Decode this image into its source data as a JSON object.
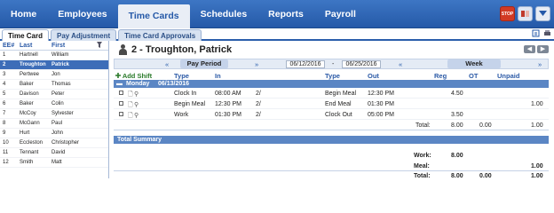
{
  "nav": {
    "items": [
      "Home",
      "Employees",
      "Time Cards",
      "Schedules",
      "Reports",
      "Payroll"
    ],
    "active": "Time Cards"
  },
  "top_icons": [
    "stop-icon",
    "book-icon",
    "dropdown-icon"
  ],
  "top_icon_text": {
    "stop": "STOP"
  },
  "subtabs": [
    "Time Card",
    "Pay Adjustment",
    "Time Card Approvals"
  ],
  "employee_list": {
    "headers": {
      "id": "EE#",
      "last": "Last",
      "first": "First"
    },
    "rows": [
      {
        "id": "1",
        "last": "Hartnell",
        "first": "William"
      },
      {
        "id": "2",
        "last": "Troughton",
        "first": "Patrick"
      },
      {
        "id": "3",
        "last": "Pertwee",
        "first": "Jon"
      },
      {
        "id": "4",
        "last": "Baker",
        "first": "Thomas"
      },
      {
        "id": "5",
        "last": "Davison",
        "first": "Peter"
      },
      {
        "id": "6",
        "last": "Baker",
        "first": "Colin"
      },
      {
        "id": "7",
        "last": "McCoy",
        "first": "Sylvester"
      },
      {
        "id": "8",
        "last": "McGann",
        "first": "Paul"
      },
      {
        "id": "9",
        "last": "Hurt",
        "first": "John"
      },
      {
        "id": "10",
        "last": "Eccleston",
        "first": "Christopher"
      },
      {
        "id": "11",
        "last": "Tennant",
        "first": "David"
      },
      {
        "id": "12",
        "last": "Smith",
        "first": "Matt"
      }
    ],
    "selected": "2"
  },
  "timecard": {
    "title": "2 - Troughton, Patrick",
    "period": {
      "prev": "«",
      "label": "Pay Period",
      "next": "»",
      "start": "06/12/2016",
      "separator": "-",
      "end": "06/25/2016",
      "week_prev": "«",
      "week_label": "Week",
      "week_next": "»"
    },
    "columns": {
      "add_shift": "Add Shift",
      "type": "Type",
      "in": "In",
      "type2": "Type",
      "out": "Out",
      "reg": "Reg",
      "ot": "OT",
      "unpaid": "Unpaid"
    },
    "day": {
      "name": "Monday",
      "date": "06/13/2016"
    },
    "shifts": [
      {
        "type": "Clock In",
        "in": "08:00 AM",
        "in_day": "2/",
        "type2": "Begin Meal",
        "out": "12:30 PM",
        "reg": "4.50",
        "ot": "",
        "unpaid": ""
      },
      {
        "type": "Begin Meal",
        "in": "12:30 PM",
        "in_day": "2/",
        "type2": "End Meal",
        "out": "01:30 PM",
        "reg": "",
        "ot": "",
        "unpaid": "1.00"
      },
      {
        "type": "Work",
        "in": "01:30 PM",
        "in_day": "2/",
        "type2": "Clock Out",
        "out": "05:00 PM",
        "reg": "3.50",
        "ot": "",
        "unpaid": ""
      }
    ],
    "day_total": {
      "label": "Total:",
      "reg": "8.00",
      "ot": "0.00",
      "unpaid": "1.00"
    },
    "summary": {
      "title": "Total Summary",
      "rows": [
        {
          "label": "Work:",
          "reg": "8.00",
          "ot": "",
          "unpaid": ""
        },
        {
          "label": "Meal:",
          "reg": "",
          "ot": "",
          "unpaid": "1.00"
        },
        {
          "label": "Total:",
          "reg": "8.00",
          "ot": "0.00",
          "unpaid": "1.00"
        }
      ]
    }
  }
}
